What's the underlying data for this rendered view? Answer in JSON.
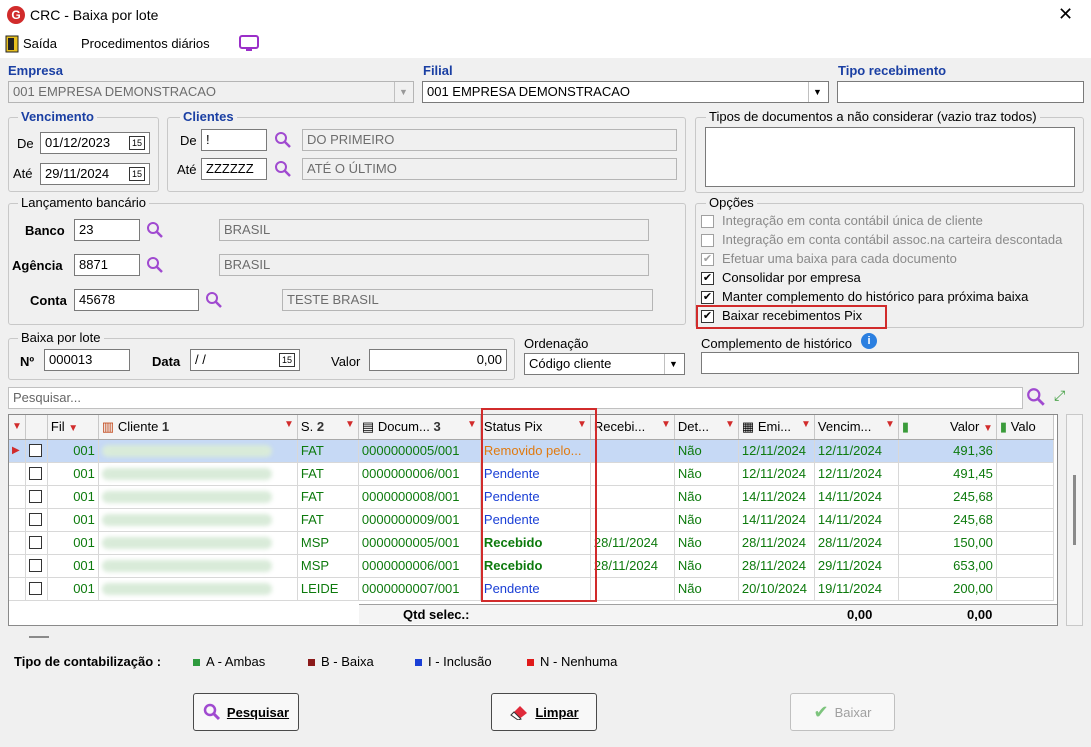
{
  "window": {
    "title": "CRC - Baixa por lote"
  },
  "menu": {
    "exit": "Saída",
    "daily": "Procedimentos diários"
  },
  "empresa": {
    "label": "Empresa",
    "value": "001 EMPRESA DEMONSTRACAO"
  },
  "filial": {
    "label": "Filial",
    "value": "001 EMPRESA DEMONSTRACAO"
  },
  "tipo_receb": {
    "label": "Tipo recebimento",
    "value": ""
  },
  "vencimento": {
    "title": "Vencimento",
    "de_label": "De",
    "de": "01/12/2023",
    "ate_label": "Até",
    "ate": "29/11/2024"
  },
  "clientes": {
    "title": "Clientes",
    "de_label": "De",
    "de_code": "!",
    "de_name": "DO PRIMEIRO",
    "ate_label": "Até",
    "ate_code": "ZZZZZZ",
    "ate_name": "ATÉ O ÚLTIMO"
  },
  "tipos_doc": {
    "title": "Tipos de documentos a não considerar (vazio traz todos)",
    "value": ""
  },
  "lanc": {
    "title": "Lançamento bancário",
    "banco_label": "Banco",
    "banco": "23",
    "banco_name": "BRASIL",
    "agencia_label": "Agência",
    "agencia": "8871",
    "agencia_name": "BRASIL",
    "conta_label": "Conta",
    "conta": "45678",
    "conta_name": "TESTE BRASIL"
  },
  "opcoes": {
    "title": "Opções",
    "items": [
      {
        "label": "Integração em conta contábil única de cliente",
        "checked": false,
        "disabled": true
      },
      {
        "label": "Integração em conta contábil assoc.na carteira descontada",
        "checked": false,
        "disabled": true
      },
      {
        "label": "Efetuar uma baixa para cada documento",
        "checked": true,
        "disabled": true
      },
      {
        "label": "Consolidar por empresa",
        "checked": true,
        "disabled": false
      },
      {
        "label": "Manter complemento do histórico para próxima baixa",
        "checked": true,
        "disabled": false
      },
      {
        "label": "Baixar recebimentos Pix",
        "checked": true,
        "disabled": false
      }
    ]
  },
  "baixa_lote": {
    "title": "Baixa por lote",
    "num_label": "Nº",
    "num": "000013",
    "data_label": "Data",
    "data": " / /",
    "valor_label": "Valor",
    "valor": "0,00"
  },
  "ordenacao": {
    "label": "Ordenação",
    "value": "Código cliente"
  },
  "complemento": {
    "label": "Complemento de histórico",
    "value": ""
  },
  "search": {
    "placeholder": "Pesquisar..."
  },
  "grid": {
    "headers": {
      "fil": "Fil",
      "cliente": "Cliente",
      "cliente_sort": "1",
      "serie": "S.",
      "serie_sort": "2",
      "documento": "Docum...",
      "documento_sort": "3",
      "status": "Status Pix",
      "recebimento": "Recebi...",
      "det": "Det...",
      "emissao": "Emi...",
      "vencimento": "Vencim...",
      "valor": "Valor",
      "valor2": "Valo"
    },
    "rows": [
      {
        "fil": "001",
        "serie": "FAT",
        "doc": "0000000005/001",
        "status": "Removido pelo...",
        "status_type": "removed",
        "receb": "",
        "det": "Não",
        "emi": "12/11/2024",
        "venc": "12/11/2024",
        "valor": "491,36"
      },
      {
        "fil": "001",
        "serie": "FAT",
        "doc": "0000000006/001",
        "status": "Pendente",
        "status_type": "pending",
        "receb": "",
        "det": "Não",
        "emi": "12/11/2024",
        "venc": "12/11/2024",
        "valor": "491,45"
      },
      {
        "fil": "001",
        "serie": "FAT",
        "doc": "0000000008/001",
        "status": "Pendente",
        "status_type": "pending",
        "receb": "",
        "det": "Não",
        "emi": "14/11/2024",
        "venc": "14/11/2024",
        "valor": "245,68"
      },
      {
        "fil": "001",
        "serie": "FAT",
        "doc": "0000000009/001",
        "status": "Pendente",
        "status_type": "pending",
        "receb": "",
        "det": "Não",
        "emi": "14/11/2024",
        "venc": "14/11/2024",
        "valor": "245,68"
      },
      {
        "fil": "001",
        "serie": "MSP",
        "doc": "0000000005/001",
        "status": "Recebido",
        "status_type": "received",
        "receb": "28/11/2024",
        "det": "Não",
        "emi": "28/11/2024",
        "venc": "28/11/2024",
        "valor": "150,00"
      },
      {
        "fil": "001",
        "serie": "MSP",
        "doc": "0000000006/001",
        "status": "Recebido",
        "status_type": "received",
        "receb": "28/11/2024",
        "det": "Não",
        "emi": "28/11/2024",
        "venc": "29/11/2024",
        "valor": "653,00"
      },
      {
        "fil": "001",
        "serie": "LEIDE",
        "doc": "0000000007/001",
        "status": "Pendente",
        "status_type": "pending",
        "receb": "",
        "det": "Não",
        "emi": "20/10/2024",
        "venc": "19/11/2024",
        "valor": "200,00"
      }
    ],
    "footer": {
      "qtd_label": "Qtd selec.:",
      "total1": "0,00",
      "total2": "0,00"
    }
  },
  "legend": {
    "label": "Tipo de contabilização :",
    "items": [
      {
        "text": "A - Ambas",
        "color": "#2e9b3e"
      },
      {
        "text": "B - Baixa",
        "color": "#8b1a1a"
      },
      {
        "text": "I - Inclusão",
        "color": "#1a3fd6"
      },
      {
        "text": "N - Nenhuma",
        "color": "#e01a1a"
      }
    ]
  },
  "buttons": {
    "pesquisar": "Pesquisar",
    "limpar": "Limpar",
    "baixar": "Baixar"
  }
}
